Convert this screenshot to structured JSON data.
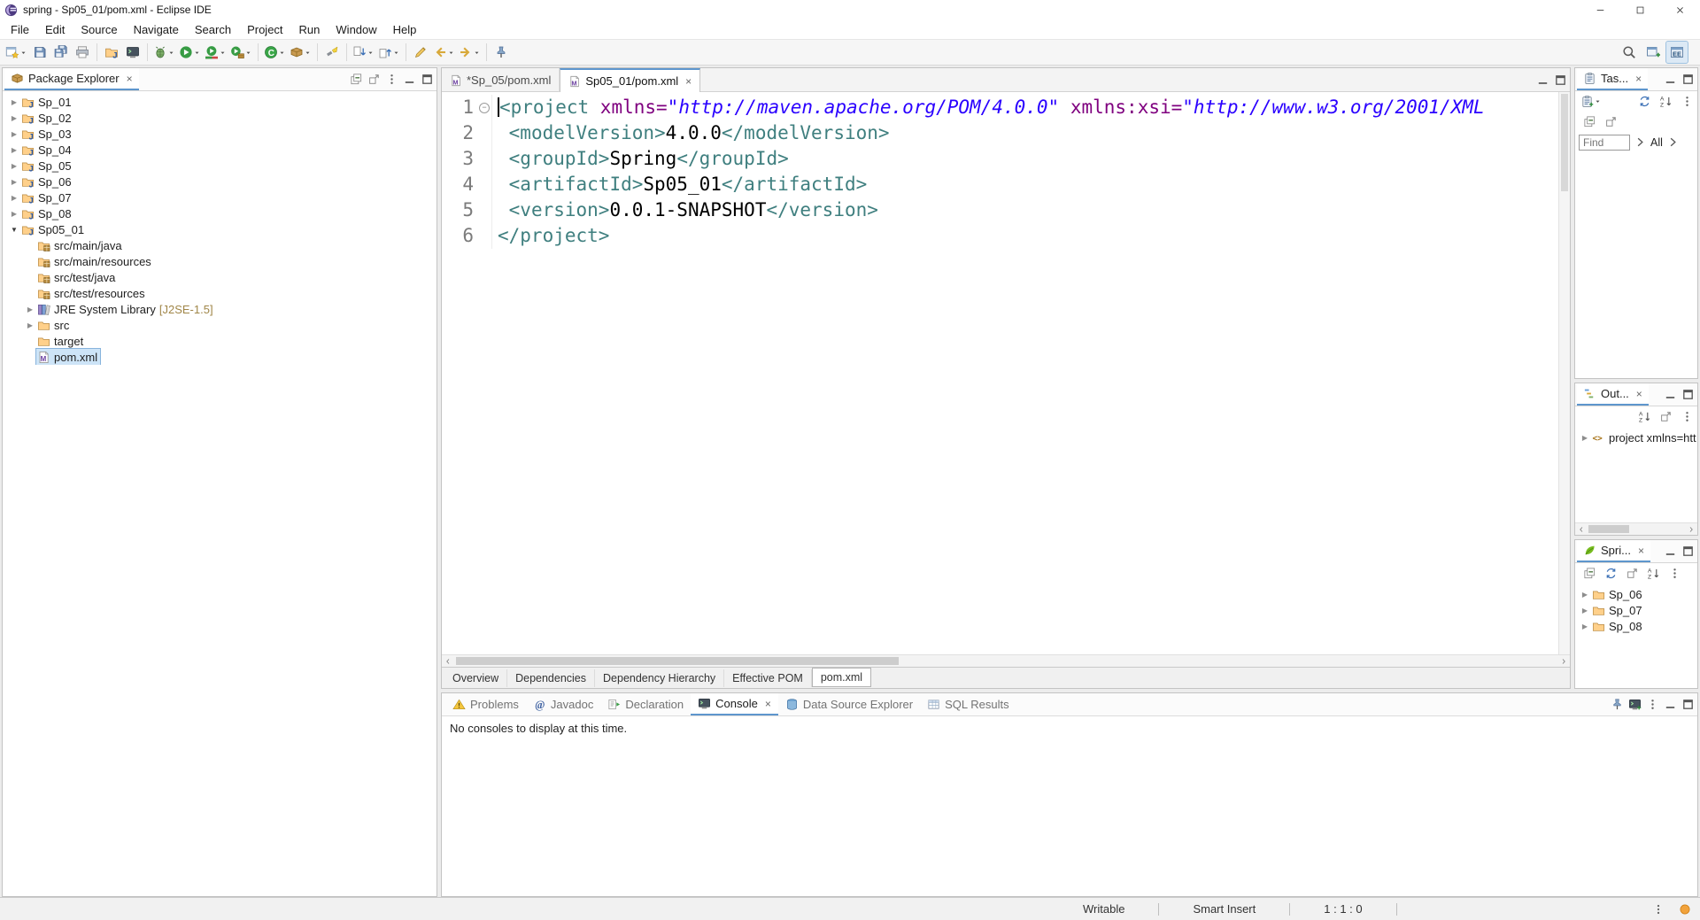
{
  "colors": {
    "accent": "#5e96cd",
    "selection": "#cde4f7",
    "syntax_tag": "#3f7f7f",
    "syntax_attr": "#7f007f",
    "syntax_value": "#2a00ff",
    "jre_suffix": "#a08648",
    "notification": "#f2a33c"
  },
  "titlebar": {
    "title": "spring - Sp05_01/pom.xml - Eclipse IDE",
    "controls": [
      "window-minimize",
      "window-maximize",
      "window-close"
    ]
  },
  "menubar": {
    "items": [
      "File",
      "Edit",
      "Source",
      "Navigate",
      "Search",
      "Project",
      "Run",
      "Window",
      "Help"
    ]
  },
  "toolbar": {
    "groups": [
      [
        {
          "name": "new-wizard",
          "dropdown": true
        },
        {
          "name": "save"
        },
        {
          "name": "save-all"
        },
        {
          "name": "print"
        }
      ],
      [
        {
          "name": "new-java-project"
        },
        {
          "name": "open-terminal"
        }
      ],
      [
        {
          "name": "debug",
          "dropdown": true
        },
        {
          "name": "run",
          "dropdown": true
        },
        {
          "name": "coverage",
          "dropdown": true
        },
        {
          "name": "external-tools",
          "dropdown": true
        }
      ],
      [
        {
          "name": "new-class",
          "dropdown": true
        },
        {
          "name": "new-package",
          "dropdown": true
        }
      ],
      [
        {
          "name": "search-flashlight"
        }
      ],
      [
        {
          "name": "next-annotation",
          "dropdown": true
        },
        {
          "name": "previous-annotation",
          "dropdown": true
        }
      ],
      [
        {
          "name": "last-edit-location"
        },
        {
          "name": "back",
          "dropdown": true
        },
        {
          "name": "forward",
          "dropdown": true
        }
      ],
      [
        {
          "name": "pin-editor"
        }
      ]
    ],
    "right": [
      {
        "name": "search"
      },
      {
        "name": "open-perspective"
      },
      {
        "name": "java-ee-perspective",
        "active": true
      }
    ]
  },
  "package_explorer": {
    "title": "Package Explorer",
    "toolbar_icons": [
      "collapse-all",
      "link-with-editor",
      "view-menu",
      "minimize",
      "maximize"
    ],
    "tree": [
      {
        "label": "Sp_01",
        "icon": "java-project",
        "arrow": "collapsed",
        "level": 0
      },
      {
        "label": "Sp_02",
        "icon": "java-project",
        "arrow": "collapsed",
        "level": 0
      },
      {
        "label": "Sp_03",
        "icon": "java-project",
        "arrow": "collapsed",
        "level": 0
      },
      {
        "label": "Sp_04",
        "icon": "java-project",
        "arrow": "collapsed",
        "level": 0
      },
      {
        "label": "Sp_05",
        "icon": "java-project",
        "arrow": "collapsed",
        "level": 0
      },
      {
        "label": "Sp_06",
        "icon": "java-project",
        "arrow": "collapsed",
        "level": 0
      },
      {
        "label": "Sp_07",
        "icon": "java-project",
        "arrow": "collapsed",
        "level": 0
      },
      {
        "label": "Sp_08",
        "icon": "java-project",
        "arrow": "collapsed",
        "level": 0
      },
      {
        "label": "Sp05_01",
        "icon": "java-project",
        "arrow": "expanded",
        "level": 0
      },
      {
        "label": "src/main/java",
        "icon": "source-folder",
        "level": 1
      },
      {
        "label": "src/main/resources",
        "icon": "source-folder",
        "level": 1
      },
      {
        "label": "src/test/java",
        "icon": "source-folder",
        "level": 1
      },
      {
        "label": "src/test/resources",
        "icon": "source-folder",
        "level": 1
      },
      {
        "label": "JRE System Library",
        "suffix": "[J2SE-1.5]",
        "icon": "library",
        "arrow": "collapsed",
        "level": 1
      },
      {
        "label": "src",
        "icon": "folder",
        "arrow": "collapsed",
        "level": 1
      },
      {
        "label": "target",
        "icon": "folder",
        "level": 1
      },
      {
        "label": "pom.xml",
        "icon": "pom-file",
        "level": 1,
        "selected": true
      }
    ]
  },
  "editor": {
    "tabs": [
      {
        "label": "*Sp_05/pom.xml",
        "icon": "pom-file",
        "active": false
      },
      {
        "label": "Sp05_01/pom.xml",
        "icon": "pom-file",
        "active": true,
        "close": true
      }
    ],
    "tab_actions": [
      "minimize",
      "maximize"
    ],
    "code_lines": [
      {
        "num": "1",
        "fold": true,
        "caret": true,
        "tokens": [
          [
            "tag",
            "<project"
          ],
          [
            "attr",
            " xmlns="
          ],
          [
            "value",
            "\"http://maven.apache.org/POM/4.0.0\""
          ],
          [
            "attr",
            " xmlns:xsi="
          ],
          [
            "value",
            "\"http://www.w3.org/2001/XML"
          ]
        ]
      },
      {
        "num": "2",
        "tokens": [
          [
            "plain",
            " "
          ],
          [
            "tag",
            "<modelVersion>"
          ],
          [
            "plain",
            "4.0.0"
          ],
          [
            "tag",
            "</modelVersion>"
          ]
        ]
      },
      {
        "num": "3",
        "tokens": [
          [
            "plain",
            " "
          ],
          [
            "tag",
            "<groupId>"
          ],
          [
            "plain",
            "Spring"
          ],
          [
            "tag",
            "</groupId>"
          ]
        ]
      },
      {
        "num": "4",
        "tokens": [
          [
            "plain",
            " "
          ],
          [
            "tag",
            "<artifactId>"
          ],
          [
            "plain",
            "Sp05_01"
          ],
          [
            "tag",
            "</artifactId>"
          ]
        ]
      },
      {
        "num": "5",
        "tokens": [
          [
            "plain",
            " "
          ],
          [
            "tag",
            "<version>"
          ],
          [
            "plain",
            "0.0.1-SNAPSHOT"
          ],
          [
            "tag",
            "</version>"
          ]
        ]
      },
      {
        "num": "6",
        "tokens": [
          [
            "tag",
            "</project>"
          ]
        ]
      }
    ],
    "bottom_tabs": [
      {
        "label": "Overview"
      },
      {
        "label": "Dependencies"
      },
      {
        "label": "Dependency Hierarchy"
      },
      {
        "label": "Effective POM"
      },
      {
        "label": "pom.xml",
        "active": true
      }
    ]
  },
  "task_list": {
    "tab_label": "Tas...",
    "header_icons": [
      "minimize",
      "maximize"
    ],
    "new_task_icon": "new-task",
    "toolbar_row1": [
      "sync",
      "sort-az",
      "view-menu"
    ],
    "toolbar_row2": [
      "collapse-all",
      "link-with-editor"
    ],
    "find_placeholder": "Find",
    "scope_label": "All"
  },
  "outline": {
    "tab_label": "Out...",
    "header_icons": [
      "minimize",
      "maximize"
    ],
    "toolbar_icons": [
      "sort-az",
      "link-with-editor",
      "view-menu"
    ],
    "root_item": "project xmlns=htt"
  },
  "spring_explorer": {
    "tab_label": "Spri...",
    "header_icons": [
      "minimize",
      "maximize"
    ],
    "toolbar_icons": [
      "collapse-all",
      "sync",
      "link-with-editor",
      "sort-az",
      "view-menu"
    ],
    "projects": [
      "Sp_06",
      "Sp_07",
      "Sp_08"
    ]
  },
  "console": {
    "tabs": [
      {
        "label": "Problems",
        "icon": "problems"
      },
      {
        "label": "Javadoc",
        "icon": "javadoc"
      },
      {
        "label": "Declaration",
        "icon": "declaration"
      },
      {
        "label": "Console",
        "icon": "console",
        "active": true,
        "close": true
      },
      {
        "label": "Data Source Explorer",
        "icon": "data-source"
      },
      {
        "label": "SQL Results",
        "icon": "sql-results"
      }
    ],
    "toolbar_icons": [
      "pin-console",
      "open-console",
      "view-menu",
      "minimize",
      "maximize"
    ],
    "message": "No consoles to display at this time."
  },
  "statusbar": {
    "items": [
      "Writable",
      "Smart Insert",
      "1 : 1 : 0"
    ],
    "right_icons": [
      "overflow-dots",
      "notification"
    ]
  }
}
